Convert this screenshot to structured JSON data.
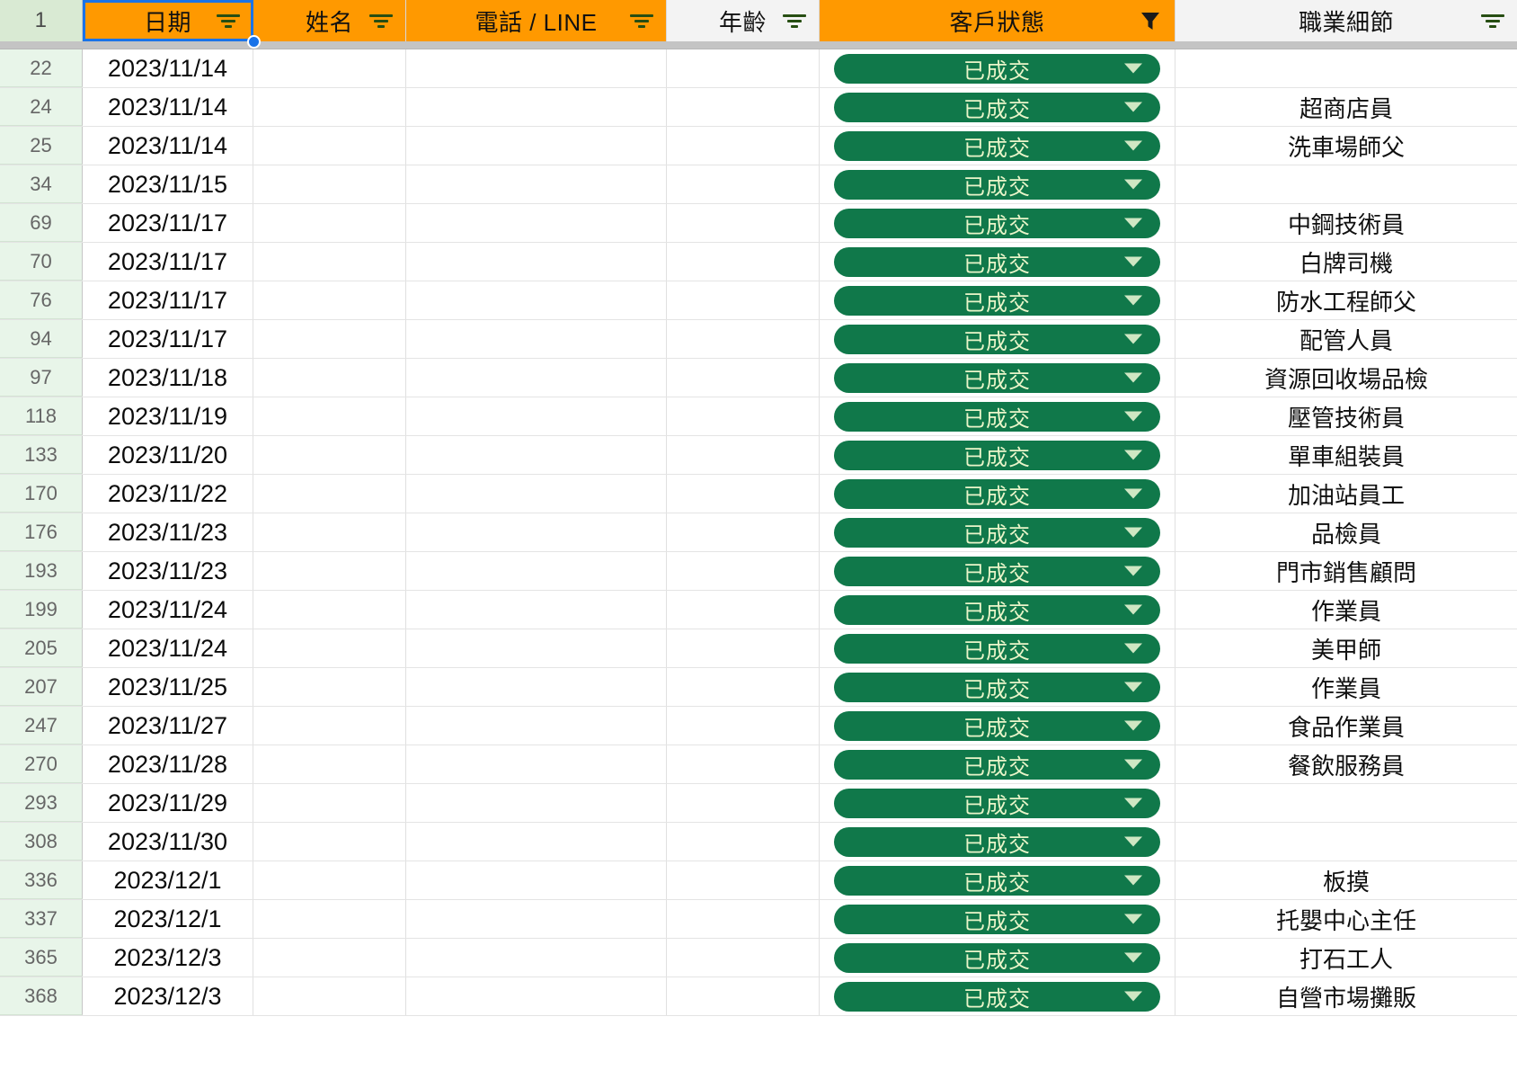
{
  "columns": [
    {
      "key": "rownum",
      "label": "1",
      "style": "rownum",
      "filter": "none"
    },
    {
      "key": "date",
      "label": "日期",
      "style": "orange",
      "filter": "bars"
    },
    {
      "key": "name",
      "label": "姓名",
      "style": "orange",
      "filter": "bars"
    },
    {
      "key": "phone",
      "label": "電話 / LINE",
      "style": "orange",
      "filter": "bars"
    },
    {
      "key": "age",
      "label": "年齡",
      "style": "plain",
      "filter": "bars"
    },
    {
      "key": "status",
      "label": "客戶狀態",
      "style": "orange",
      "filter": "funnel-solid"
    },
    {
      "key": "job",
      "label": "職業細節",
      "style": "plain",
      "filter": "bars"
    }
  ],
  "colors": {
    "header_orange": "#ff9900",
    "header_plain": "#f3f3f3",
    "rownum_header": "#d9ead3",
    "rownum_cell": "#e8f5e9",
    "chip_green": "#10784a",
    "chip_text": "#e9f5c9",
    "selection_blue": "#1a73e8",
    "filter_icon": "#274e13"
  },
  "selection": {
    "cell": "日期",
    "has_fill_handle": true
  },
  "rows": [
    {
      "rownum": "22",
      "date": "2023/11/14",
      "name": "",
      "phone": "",
      "age": "",
      "status": "已成交",
      "job": ""
    },
    {
      "rownum": "24",
      "date": "2023/11/14",
      "name": "",
      "phone": "",
      "age": "",
      "status": "已成交",
      "job": "超商店員"
    },
    {
      "rownum": "25",
      "date": "2023/11/14",
      "name": "",
      "phone": "",
      "age": "",
      "status": "已成交",
      "job": "洗車場師父"
    },
    {
      "rownum": "34",
      "date": "2023/11/15",
      "name": "",
      "phone": "",
      "age": "",
      "status": "已成交",
      "job": ""
    },
    {
      "rownum": "69",
      "date": "2023/11/17",
      "name": "",
      "phone": "",
      "age": "",
      "status": "已成交",
      "job": "中鋼技術員"
    },
    {
      "rownum": "70",
      "date": "2023/11/17",
      "name": "",
      "phone": "",
      "age": "",
      "status": "已成交",
      "job": "白牌司機"
    },
    {
      "rownum": "76",
      "date": "2023/11/17",
      "name": "",
      "phone": "",
      "age": "",
      "status": "已成交",
      "job": "防水工程師父"
    },
    {
      "rownum": "94",
      "date": "2023/11/17",
      "name": "",
      "phone": "",
      "age": "",
      "status": "已成交",
      "job": "配管人員"
    },
    {
      "rownum": "97",
      "date": "2023/11/18",
      "name": "",
      "phone": "",
      "age": "",
      "status": "已成交",
      "job": "資源回收場品檢"
    },
    {
      "rownum": "118",
      "date": "2023/11/19",
      "name": "",
      "phone": "",
      "age": "",
      "status": "已成交",
      "job": "壓管技術員"
    },
    {
      "rownum": "133",
      "date": "2023/11/20",
      "name": "",
      "phone": "",
      "age": "",
      "status": "已成交",
      "job": "單車組裝員"
    },
    {
      "rownum": "170",
      "date": "2023/11/22",
      "name": "",
      "phone": "",
      "age": "",
      "status": "已成交",
      "job": "加油站員工"
    },
    {
      "rownum": "176",
      "date": "2023/11/23",
      "name": "",
      "phone": "",
      "age": "",
      "status": "已成交",
      "job": "品檢員"
    },
    {
      "rownum": "193",
      "date": "2023/11/23",
      "name": "",
      "phone": "",
      "age": "",
      "status": "已成交",
      "job": "門市銷售顧問"
    },
    {
      "rownum": "199",
      "date": "2023/11/24",
      "name": "",
      "phone": "",
      "age": "",
      "status": "已成交",
      "job": "作業員"
    },
    {
      "rownum": "205",
      "date": "2023/11/24",
      "name": "",
      "phone": "",
      "age": "",
      "status": "已成交",
      "job": "美甲師"
    },
    {
      "rownum": "207",
      "date": "2023/11/25",
      "name": "",
      "phone": "",
      "age": "",
      "status": "已成交",
      "job": "作業員"
    },
    {
      "rownum": "247",
      "date": "2023/11/27",
      "name": "",
      "phone": "",
      "age": "",
      "status": "已成交",
      "job": "食品作業員"
    },
    {
      "rownum": "270",
      "date": "2023/11/28",
      "name": "",
      "phone": "",
      "age": "",
      "status": "已成交",
      "job": "餐飲服務員"
    },
    {
      "rownum": "293",
      "date": "2023/11/29",
      "name": "",
      "phone": "",
      "age": "",
      "status": "已成交",
      "job": ""
    },
    {
      "rownum": "308",
      "date": "2023/11/30",
      "name": "",
      "phone": "",
      "age": "",
      "status": "已成交",
      "job": ""
    },
    {
      "rownum": "336",
      "date": "2023/12/1",
      "name": "",
      "phone": "",
      "age": "",
      "status": "已成交",
      "job": "板摸"
    },
    {
      "rownum": "337",
      "date": "2023/12/1",
      "name": "",
      "phone": "",
      "age": "",
      "status": "已成交",
      "job": "托嬰中心主任"
    },
    {
      "rownum": "365",
      "date": "2023/12/3",
      "name": "",
      "phone": "",
      "age": "",
      "status": "已成交",
      "job": "打石工人"
    },
    {
      "rownum": "368",
      "date": "2023/12/3",
      "name": "",
      "phone": "",
      "age": "",
      "status": "已成交",
      "job": "自營市場攤販"
    }
  ]
}
